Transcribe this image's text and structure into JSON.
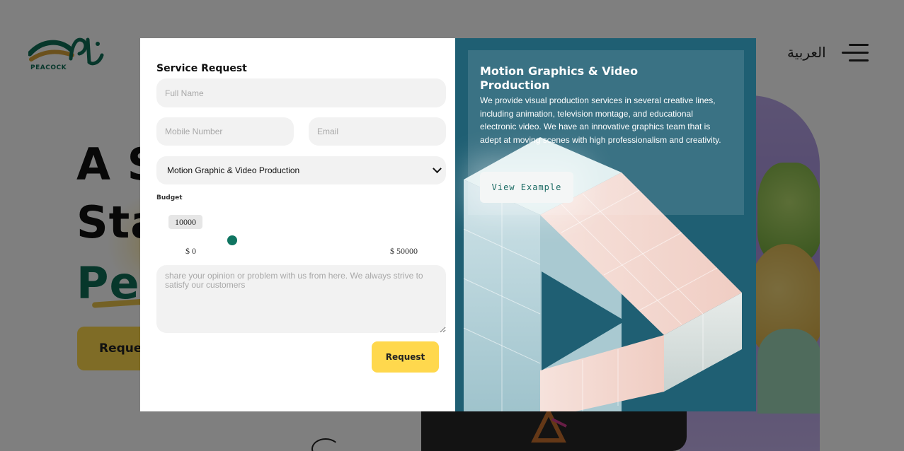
{
  "background_page": {
    "logo_text": "PEACOCK",
    "language_link": "العربية",
    "hero_lines": [
      "A S",
      "Sta",
      "Pe"
    ],
    "request_button": "Reques"
  },
  "modal": {
    "form": {
      "title": "Service Request",
      "full_name_placeholder": "Full Name",
      "mobile_placeholder": "Mobile Number",
      "email_placeholder": "Email",
      "service_selected": "Motion Graphic & Video Production",
      "budget_label": "Budget",
      "budget_value": "10000",
      "budget_min_label": "$ 0",
      "budget_max_label": "$ 50000",
      "budget_fraction": 0.2,
      "message_placeholder": "share your opinion or problem with us from here. We always strive to satisfy our customers",
      "submit_label": "Request"
    },
    "info": {
      "title": "Motion Graphics & Video Production",
      "description": "We provide visual production services in several creative lines, including animation, television montage, and educational electronic video. We have an innovative graphics team that is adept at moving scenes with high professionalism and creativity.",
      "example_button": "View Example"
    }
  },
  "colors": {
    "accent_yellow": "#ffd84d",
    "brand_green": "#0f7561",
    "info_panel_bg": "#1f5f73"
  }
}
